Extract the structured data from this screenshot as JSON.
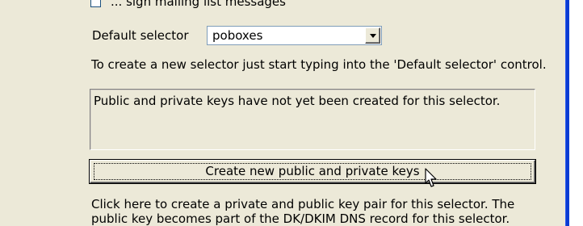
{
  "sign_option": {
    "checked": false,
    "label": "... sign mailing list messages"
  },
  "selector": {
    "label": "Default selector",
    "value": "poboxes"
  },
  "hint": "To create a new selector just start typing into the 'Default selector' control.",
  "status_message": "Public and private keys have not yet been created for this selector.",
  "create_keys_button": {
    "label": "Create new public and private keys"
  },
  "explanation": {
    "line1": "Click here to create a private and public key pair for this selector.  The",
    "line2": "public key becomes part of the DK/DKIM DNS record for this selector."
  },
  "colors": {
    "dialog_background": "#ece9d8",
    "window_border": "#0a3bd2"
  },
  "icons": {
    "dropdown": "chevron-down-icon",
    "cursor": "mouse-pointer-icon"
  }
}
